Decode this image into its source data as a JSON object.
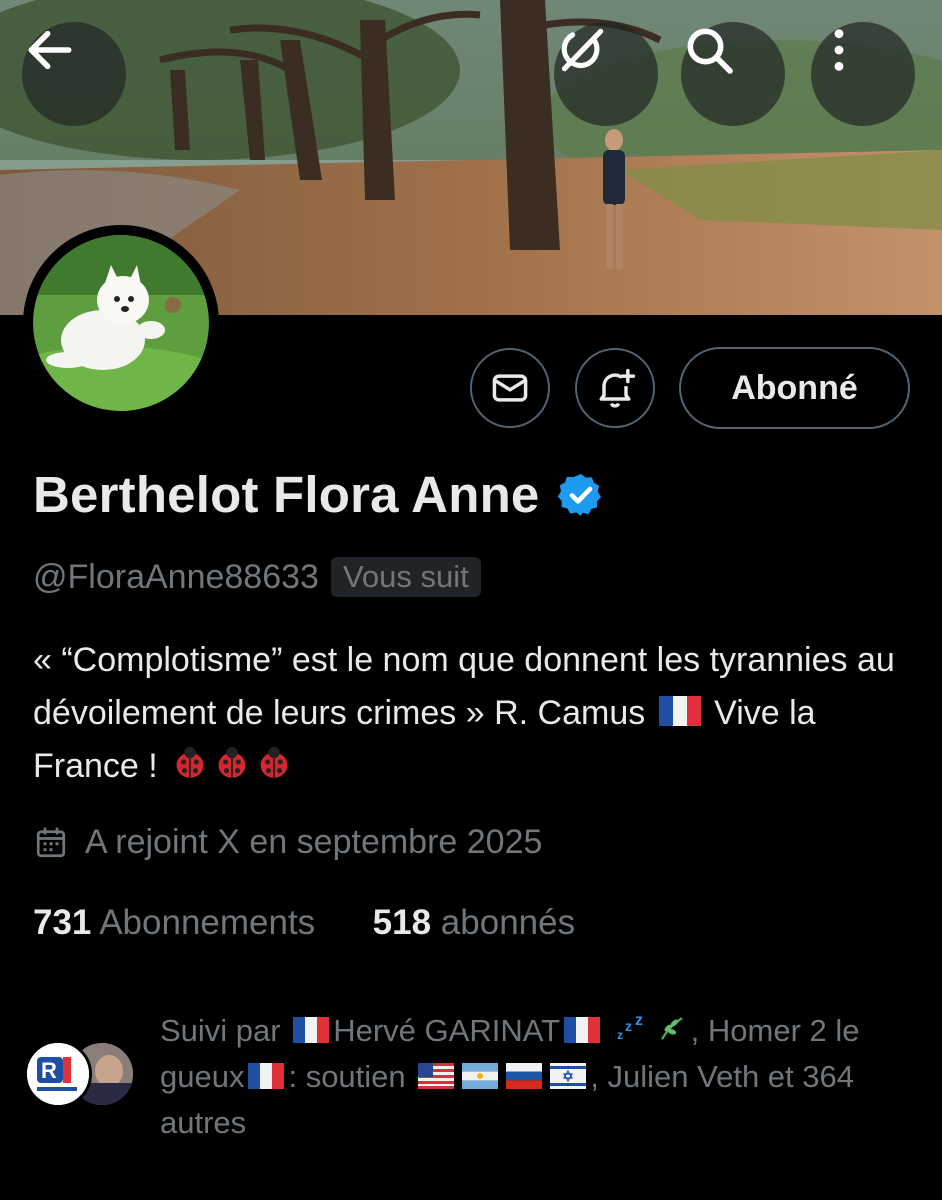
{
  "header": {
    "back_icon": "arrow-left-icon",
    "grok_icon": "grok-icon",
    "search_icon": "search-icon",
    "more_icon": "more-vertical-icon"
  },
  "profile": {
    "display_name": "Berthelot Flora Anne",
    "handle": "@FloraAnne88633",
    "follows_you_badge": "Vous suit",
    "bio_text": "« “Complotisme” est le nom que donnent les tyrannies au dévoilement de leurs crimes » R. Camus",
    "bio_tail": "Vive la France !",
    "joined": "A rejoint X en septembre 2025",
    "following_count": "731",
    "following_label": "Abonnements",
    "followers_count": "518",
    "followers_label": "abonnés"
  },
  "actions": {
    "message_icon": "mail-icon",
    "notify_icon": "bell-plus-icon",
    "follow_label": "Abonné"
  },
  "followed_by": {
    "prefix": "Suivi par",
    "name1": "Hervé GARINAT",
    "name1_suffix": ",",
    "name2": "Homer 2 le gueux",
    "name2_suffix": ": soutien",
    "tail": ", Julien Veth et 364 autres"
  },
  "colors": {
    "background": "#000000",
    "text_primary": "#e7e9ea",
    "text_secondary": "#71767b",
    "border": "#536471",
    "verified_blue": "#1d9bf0"
  }
}
